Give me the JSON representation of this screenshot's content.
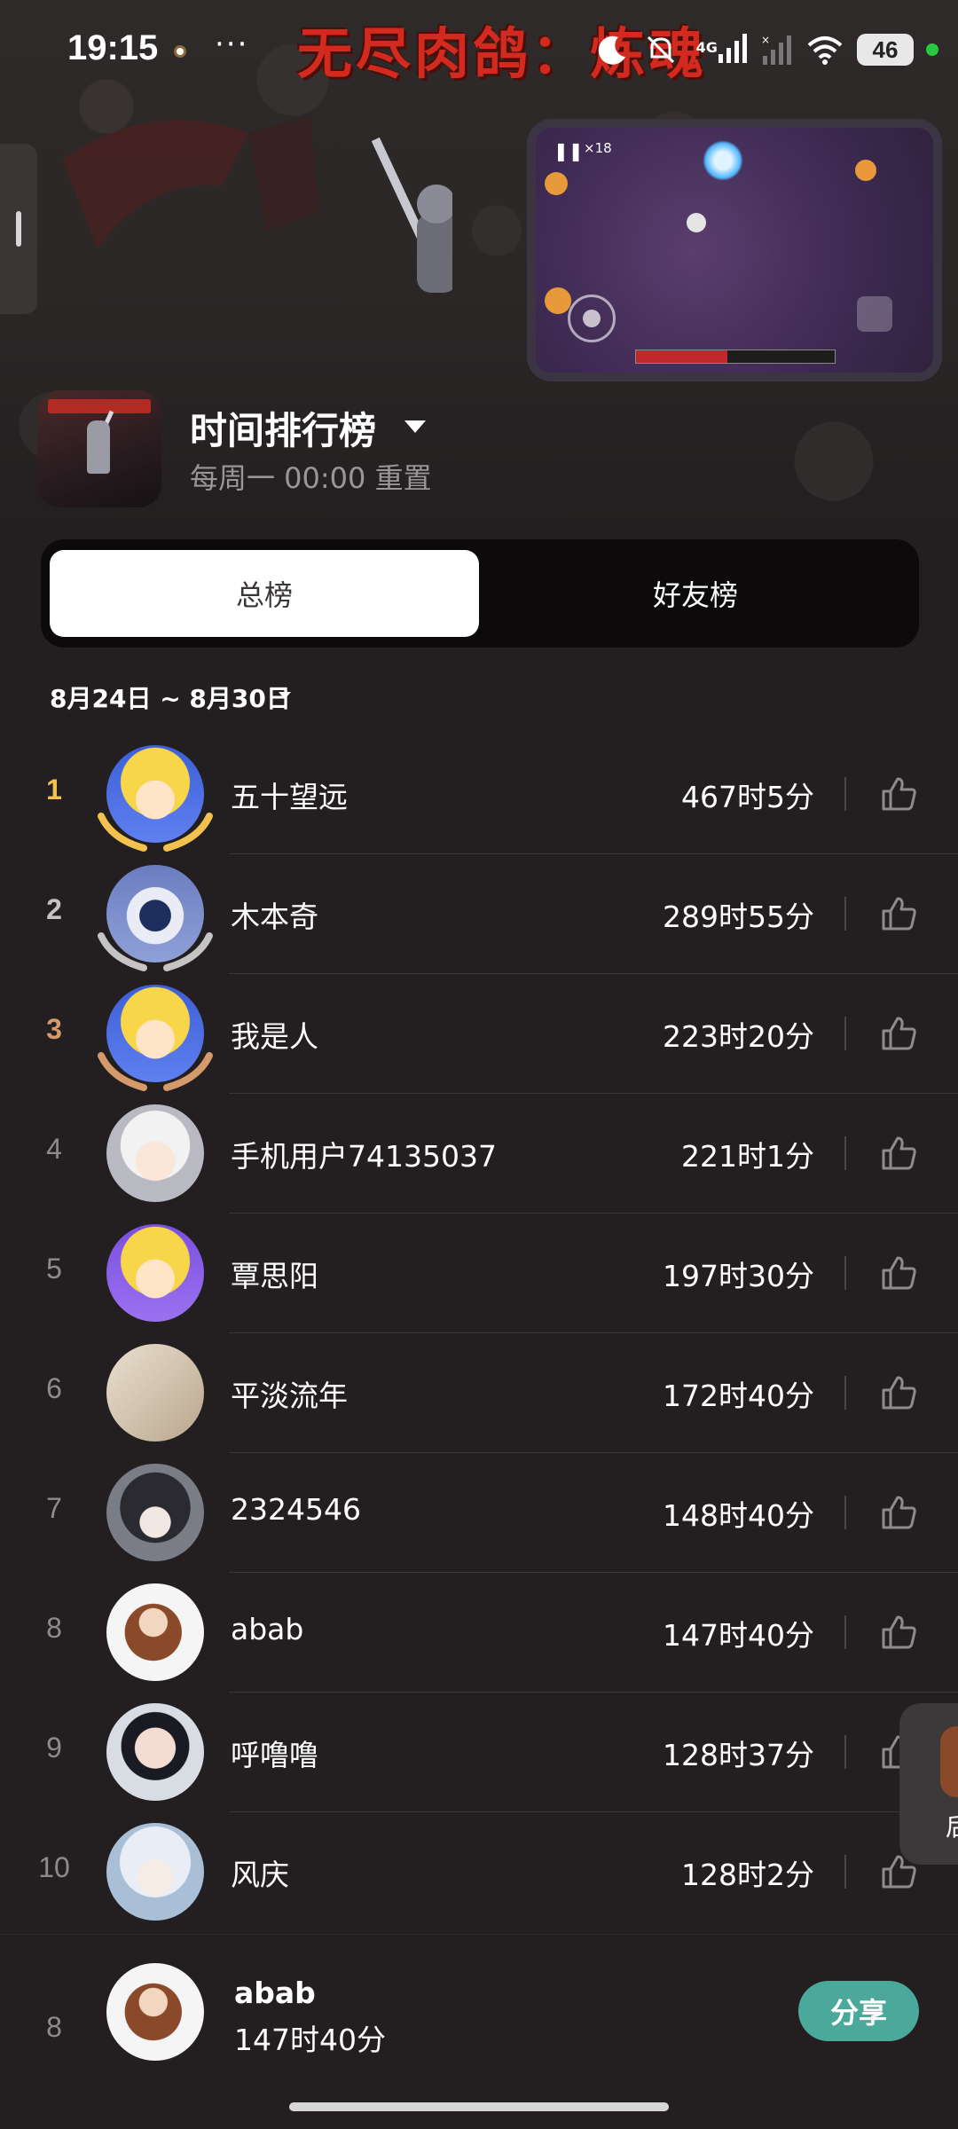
{
  "status_bar": {
    "time": "19:15",
    "more": "···",
    "network": "4G",
    "battery": "46"
  },
  "background": {
    "game_title_art": "无尽肉鸽：炼魂"
  },
  "game_preview": {
    "counter": "×18"
  },
  "header": {
    "title": "时间排行榜",
    "reset_text": "每周一 00:00 重置"
  },
  "tabs": {
    "overall": "总榜",
    "friends": "好友榜",
    "active": "overall"
  },
  "date_range": "8月24日 ~ 8月30日",
  "leaderboard": [
    {
      "rank": "1",
      "name": "五十望远",
      "time": "467时5分",
      "medal": "gold"
    },
    {
      "rank": "2",
      "name": "木本奇",
      "time": "289时55分",
      "medal": "silver"
    },
    {
      "rank": "3",
      "name": "我是人",
      "time": "223时20分",
      "medal": "bronze"
    },
    {
      "rank": "4",
      "name": "手机用户74135037",
      "time": "221时1分",
      "medal": ""
    },
    {
      "rank": "5",
      "name": "覃思阳",
      "time": "197时30分",
      "medal": ""
    },
    {
      "rank": "6",
      "name": "平淡流年",
      "time": "172时40分",
      "medal": ""
    },
    {
      "rank": "7",
      "name": "2324546",
      "time": "148时40分",
      "medal": ""
    },
    {
      "rank": "8",
      "name": "abab",
      "time": "147时40分",
      "medal": ""
    },
    {
      "rank": "9",
      "name": "呼噜噜",
      "time": "128时37分",
      "medal": ""
    },
    {
      "rank": "10",
      "name": "风庆",
      "time": "128时2分",
      "medal": ""
    }
  ],
  "float_tab": {
    "text": "后"
  },
  "my_rank": {
    "rank": "8",
    "name": "abab",
    "time": "147时40分",
    "share_label": "分享"
  },
  "colors": {
    "background": "#231f20",
    "gold": "#f3c24e",
    "silver": "#c4c4c4",
    "bronze": "#d59a6b",
    "share_button": "#4aa99a"
  },
  "icons": {
    "like": "thumbs-up-icon",
    "dropdown": "caret-down-icon"
  }
}
